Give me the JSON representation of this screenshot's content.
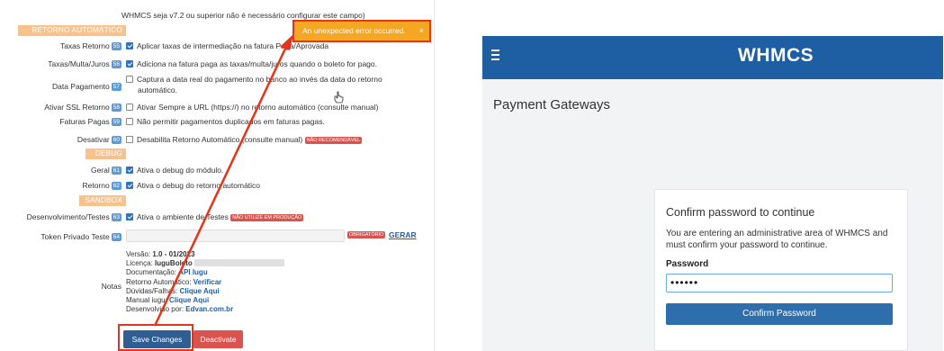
{
  "left": {
    "top_note": "WHMCS seja v7.2 ou superior não é necessário configurar este campo)",
    "sections": {
      "retorno": "RETORNO AUTOMÁTICO",
      "debug": "DEBUG",
      "sandbox": "SANDBOX"
    },
    "rows": [
      {
        "label": "Taxas Retorno",
        "num": "55",
        "checked": true,
        "text": "Aplicar taxas de intermediação na fatura Paga/Aprovada"
      },
      {
        "label": "Taxas/Multa/Juros",
        "num": "56",
        "checked": true,
        "text": "Adiciona na fatura paga as taxas/multa/juros quando o boleto for pago."
      },
      {
        "label": "Data Pagamento",
        "num": "57",
        "checked": false,
        "text": "Captura a data real do pagamento no banco ao invés da data do retorno",
        "text2": "automático."
      },
      {
        "label": "Ativar SSL Retorno",
        "num": "58",
        "checked": false,
        "text": "Ativar Sempre a URL (https://) no retorno automático (consulte manual)"
      },
      {
        "label": "Faturas Pagas",
        "num": "59",
        "checked": false,
        "text": "Não permitir pagamentos duplicados em faturas pagas."
      },
      {
        "label": "Desativar",
        "num": "60",
        "checked": false,
        "text": "Desabilita Retorno Automático (consulte manual)",
        "badge": "NÃO RECOMENDÁVEL"
      },
      {
        "label": "Geral",
        "num": "61",
        "checked": true,
        "text": "Ativa o debug do módulo."
      },
      {
        "label": "Retorno",
        "num": "62",
        "checked": true,
        "text": "Ativa o debug do retorno automático"
      },
      {
        "label": "Desenvolvimento/Testes",
        "num": "63",
        "checked": true,
        "text": "Ativa o ambiente de Testes",
        "badge": "NÃO UTILIZE EM PRODUÇÃO"
      }
    ],
    "token": {
      "label": "Token Privado Teste",
      "num": "64",
      "required": "OBRIGATÓRIO",
      "generate": "GERAR"
    },
    "notes": {
      "label": "Notas",
      "versao_k": "Versão:",
      "versao_v": "1.0 - 01/2023",
      "licenca_k": "Licença:",
      "licenca_v": "IuguBoleto",
      "doc_k": "Documentação:",
      "doc_v": "API Iugu",
      "ret_k": "Retorno Automático:",
      "ret_v": "Verificar",
      "duv_k": "Dúvidas/Falhas:",
      "duv_v": "Clique Aqui",
      "man_k": "Manual iugu:",
      "man_v": "Clique Aqui",
      "dev_k": "Desenvolvido por:",
      "dev_v": "Edvan.com.br"
    },
    "buttons": {
      "save": "Save Changes",
      "deactivate": "Deactivate"
    },
    "toast": {
      "message": "An unexpected error occurred.",
      "close": "×"
    },
    "colors": {
      "toast": "#f5a623",
      "annotation": "#e8321a",
      "section": "#f7c28c"
    }
  },
  "right": {
    "logo": "WHMCS",
    "page_title": "Payment Gateways",
    "card": {
      "title": "Confirm password to continue",
      "message": "You are entering an administrative area of WHMCS and must confirm your password to continue.",
      "password_label": "Password",
      "password_value": "••••••",
      "button": "Confirm Password"
    },
    "colors": {
      "navbar": "#1e5fa3",
      "button": "#2f6ead"
    }
  }
}
